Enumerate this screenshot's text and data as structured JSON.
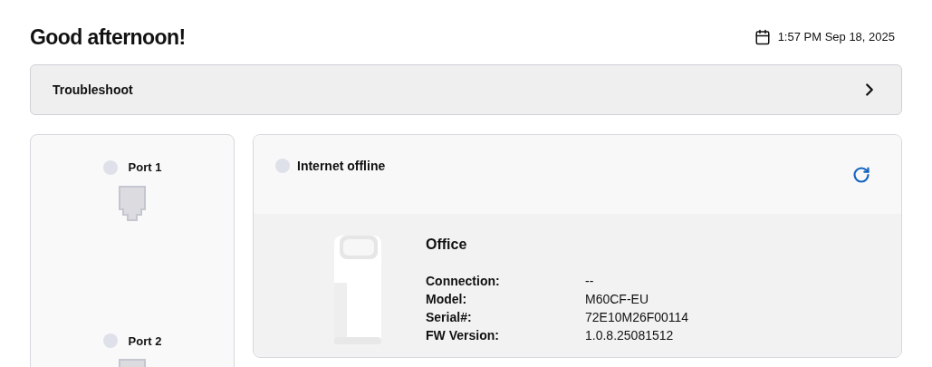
{
  "greeting": "Good afternoon!",
  "datetime": "1:57 PM Sep 18, 2025",
  "troubleshoot": {
    "label": "Troubleshoot"
  },
  "ports": [
    {
      "label": "Port 1",
      "connected": false
    },
    {
      "label": "Port 2",
      "connected": false
    }
  ],
  "internet": {
    "status": "Internet offline",
    "connected": false
  },
  "device": {
    "name": "Office",
    "details": [
      {
        "label": "Connection:",
        "value": "--"
      },
      {
        "label": "Model:",
        "value": "M60CF-EU"
      },
      {
        "label": "Serial#:",
        "value": "72E10M26F00114"
      },
      {
        "label": "FW Version:",
        "value": "1.0.8.25081512"
      }
    ]
  }
}
